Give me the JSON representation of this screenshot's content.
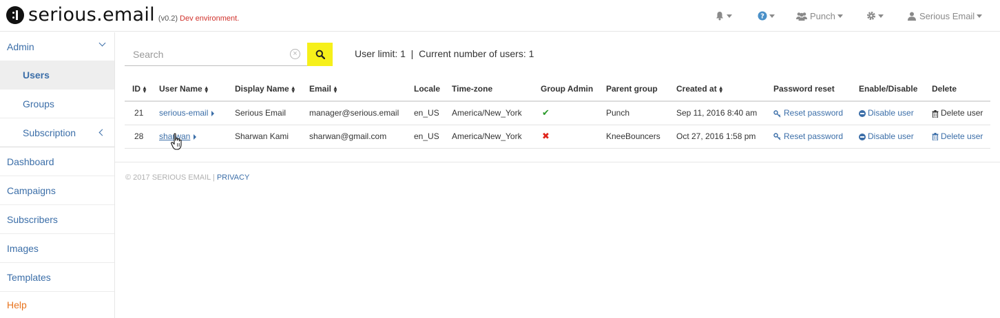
{
  "header": {
    "logo_text": "serious.email",
    "version": "(v0.2)",
    "environment": "Dev environment.",
    "nav": {
      "notifications_icon": "bell-icon",
      "help_icon": "question-circle-icon",
      "group_label": "Punch",
      "settings_icon": "gear-icon",
      "user_label": "Serious Email"
    }
  },
  "sidebar": {
    "admin": "Admin",
    "users": "Users",
    "groups": "Groups",
    "subscription": "Subscription",
    "dashboard": "Dashboard",
    "campaigns": "Campaigns",
    "subscribers": "Subscribers",
    "images": "Images",
    "templates": "Templates",
    "help": "Help"
  },
  "search": {
    "placeholder": "Search",
    "value": ""
  },
  "limits": {
    "text": "User limit: 1  |  Current number of users: 1"
  },
  "table": {
    "headers": {
      "id": "ID",
      "user_name": "User Name",
      "display_name": "Display Name",
      "email": "Email",
      "locale": "Locale",
      "timezone": "Time-zone",
      "group_admin": "Group Admin",
      "parent_group": "Parent group",
      "created_at": "Created at",
      "password_reset": "Password reset",
      "enable_disable": "Enable/Disable",
      "delete": "Delete"
    },
    "rows": [
      {
        "id": "21",
        "user_name": "serious-email",
        "display_name": "Serious Email",
        "email": "manager@serious.email",
        "locale": "en_US",
        "timezone": "America/New_York",
        "group_admin": "✔",
        "parent_group": "Punch",
        "created_at": "Sep 11, 2016 8:40 am",
        "password_reset": "Reset password",
        "enable_disable": "Disable user",
        "delete": "Delete user"
      },
      {
        "id": "28",
        "user_name": "sharwan",
        "display_name": "Sharwan Kami",
        "email": "sharwan@gmail.com",
        "locale": "en_US",
        "timezone": "America/New_York",
        "group_admin": "✖",
        "parent_group": "KneeBouncers",
        "created_at": "Oct 27, 2016 1:58 pm",
        "password_reset": "Reset password",
        "enable_disable": "Disable user",
        "delete": "Delete user"
      }
    ]
  },
  "footer": {
    "copyright": "© 2017 SERIOUS EMAIL | ",
    "privacy": "PRIVACY"
  },
  "colors": {
    "link": "#3b6ea8",
    "search_button": "#f6f01a",
    "env_text": "#d0302a",
    "help": "#e8731c"
  }
}
